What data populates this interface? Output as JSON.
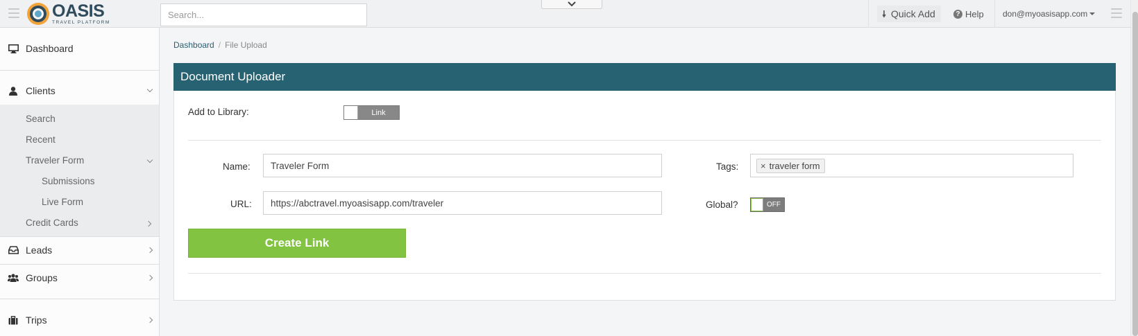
{
  "header": {
    "logo_name": "OASIS",
    "logo_tagline": "TRAVEL PLATFORM",
    "search_placeholder": "Search...",
    "quick_add_label": "Quick Add",
    "help_label": "Help",
    "user_email": "don@myoasisapp.com"
  },
  "sidebar": {
    "items": [
      {
        "label": "Dashboard",
        "icon": "desktop-icon"
      },
      {
        "label": "Clients",
        "icon": "user-icon",
        "expanded": true
      },
      {
        "label": "Leads",
        "icon": "inbox-icon"
      },
      {
        "label": "Groups",
        "icon": "users-icon"
      },
      {
        "label": "Trips",
        "icon": "suitcase-icon"
      }
    ],
    "client_subitems": [
      "Search",
      "Recent",
      "Traveler Form",
      "Credit Cards"
    ],
    "traveler_form_subitems": [
      "Submissions",
      "Live Form"
    ]
  },
  "breadcrumb": {
    "home": "Dashboard",
    "separator": "/",
    "current": "File Upload"
  },
  "panel": {
    "title": "Document Uploader",
    "add_to_library_label": "Add to Library:",
    "add_to_library_toggle": "Link",
    "name_label": "Name:",
    "name_value": "Traveler Form",
    "url_label": "URL:",
    "url_value": "https://abctravel.myoasisapp.com/traveler",
    "tags_label": "Tags:",
    "tags": [
      "traveler form"
    ],
    "tag_remove": "×",
    "global_label": "Global?",
    "global_toggle": "OFF",
    "create_button": "Create Link"
  },
  "colors": {
    "panel_header": "#266272",
    "create_button": "#82c341",
    "link": "#2a5d70"
  }
}
